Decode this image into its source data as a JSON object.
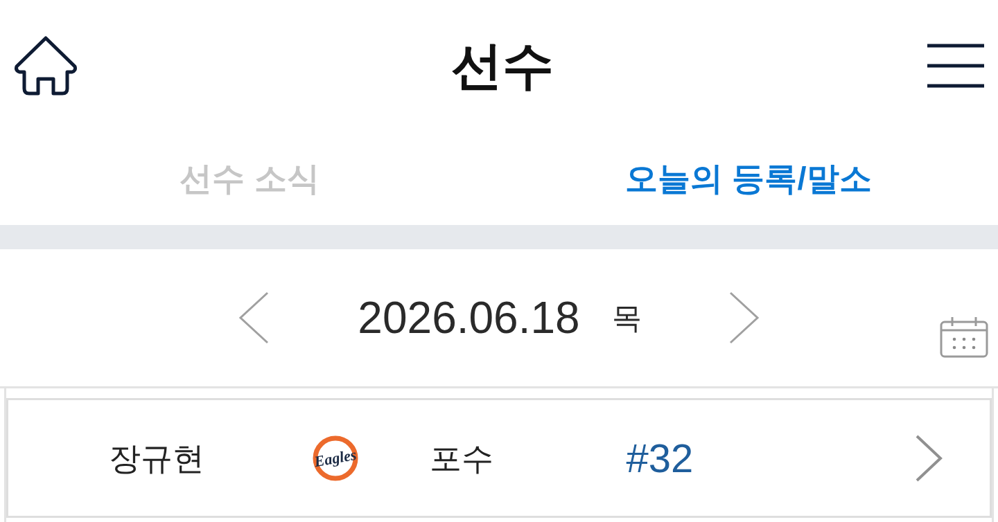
{
  "header": {
    "title": "선수"
  },
  "tabs": [
    {
      "label": "선수 소식",
      "selected": false
    },
    {
      "label": "오늘의 등록/말소",
      "selected": true
    }
  ],
  "date_nav": {
    "date": "2026.06.18",
    "weekday": "목"
  },
  "players": [
    {
      "name": "장규현",
      "team_logo": "Eagles",
      "position": "포수",
      "number": "#32"
    }
  ]
}
